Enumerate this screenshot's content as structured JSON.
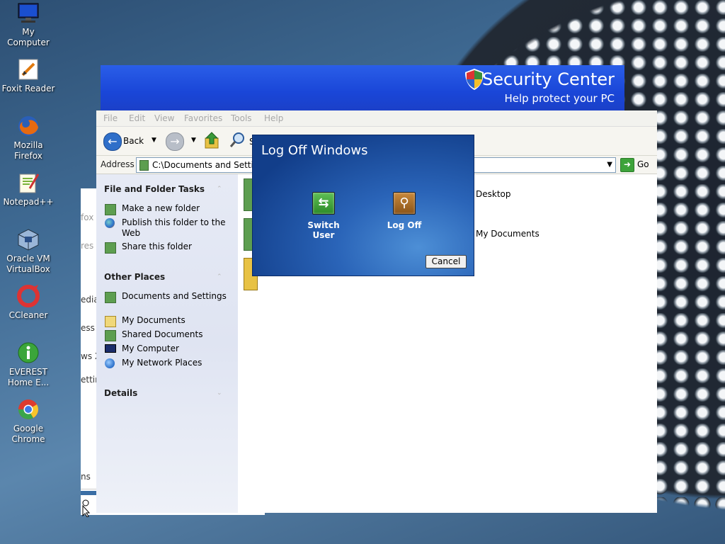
{
  "desktop": {
    "icons": [
      {
        "label": "My Computer",
        "icon": "my-computer-icon"
      },
      {
        "label": "Foxit Reader",
        "icon": "foxit-reader-icon"
      },
      {
        "label": "Mozilla Firefox",
        "icon": "firefox-icon"
      },
      {
        "label": "Notepad++",
        "icon": "notepad-plus-plus-icon"
      },
      {
        "label": "Oracle VM VirtualBox",
        "icon": "virtualbox-icon"
      },
      {
        "label": "CCleaner",
        "icon": "ccleaner-icon"
      },
      {
        "label": "EVEREST Home E...",
        "icon": "everest-icon"
      },
      {
        "label": "Google Chrome",
        "icon": "chrome-icon"
      }
    ],
    "background_window_fragments": [
      "fox",
      "res",
      "edia",
      "ess",
      "ws X",
      "ettin",
      "ns"
    ]
  },
  "security_center": {
    "title": "Security Center",
    "subtitle": "Help protect your PC"
  },
  "explorer": {
    "menu": [
      "File",
      "Edit",
      "View",
      "Favorites",
      "Tools",
      "Help"
    ],
    "toolbar": {
      "back_label": "Back",
      "search_label_partial": "S"
    },
    "address": {
      "label": "Address",
      "value": "C:\\Documents and Settings",
      "go_label": "Go"
    },
    "task_pane": {
      "file_folder_tasks": {
        "heading": "File and Folder Tasks",
        "items": [
          "Make a new folder",
          "Publish this folder to the Web",
          "Share this folder"
        ]
      },
      "other_places": {
        "heading": "Other Places",
        "items": [
          "Documents and Settings",
          "My Documents",
          "Shared Documents",
          "My Computer",
          "My Network Places"
        ]
      },
      "details": {
        "heading": "Details"
      }
    },
    "content": {
      "items": [
        "Desktop",
        "My Documents"
      ]
    }
  },
  "logoff_dialog": {
    "title": "Log Off Windows",
    "switch_user_label": "Switch User",
    "log_off_label": "Log Off",
    "cancel_label": "Cancel"
  },
  "colors": {
    "dialog_blue": "#2a64b8",
    "banner_blue": "#1a46d8",
    "switch_user_green": "#3d9a35",
    "log_off_brown": "#a86a28"
  }
}
